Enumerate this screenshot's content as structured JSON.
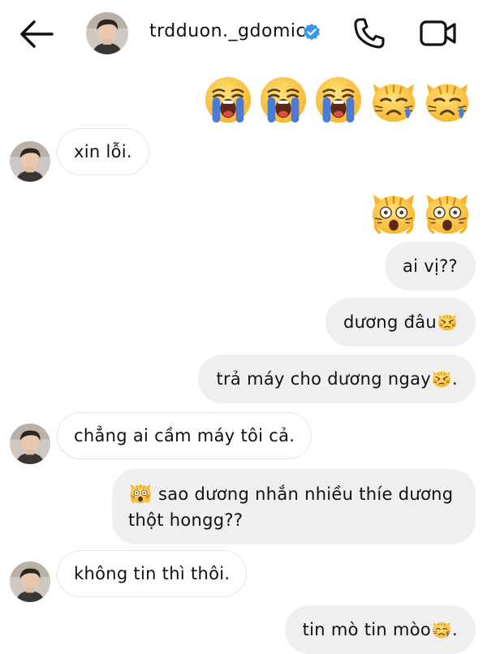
{
  "header": {
    "username": "trdduon._gdomic",
    "icons": {
      "back": "arrow-left-icon",
      "verified": "verified-badge-icon",
      "call": "phone-icon",
      "video": "video-camera-icon"
    }
  },
  "colors": {
    "verified": "#3897f0",
    "outgoing_bubble": "#efefef",
    "incoming_border": "#e6e6e6",
    "emoji_yellow": "#ffcb3d",
    "tear_blue": "#4a7bd8"
  },
  "messages": {
    "m1": {
      "emojis": [
        "loudly-crying-face",
        "loudly-crying-face",
        "loudly-crying-face",
        "crying-cat-face",
        "crying-cat-face"
      ]
    },
    "m2": {
      "text": "xin lỗi."
    },
    "m3": {
      "emojis": [
        "weary-cat-face",
        "weary-cat-face"
      ]
    },
    "m4": {
      "text": "ai vị??"
    },
    "m5": {
      "text": "dương đâu",
      "emoji": "pouting-cat-face"
    },
    "m6": {
      "text": "trả máy cho dương ngay",
      "emoji": "pouting-cat-face",
      "suffix": "."
    },
    "m7": {
      "text": "chẳng ai cầm máy tôi cả."
    },
    "m8": {
      "emoji": "weary-cat-face",
      "line1": " sao dương nhắn nhiều thíe dương",
      "line2": "thột hongg??"
    },
    "m9": {
      "text": "không tin thì thôi."
    },
    "m10": {
      "text": "tin mò tin mòo",
      "emoji": "crying-cat-face",
      "suffix": "."
    }
  }
}
